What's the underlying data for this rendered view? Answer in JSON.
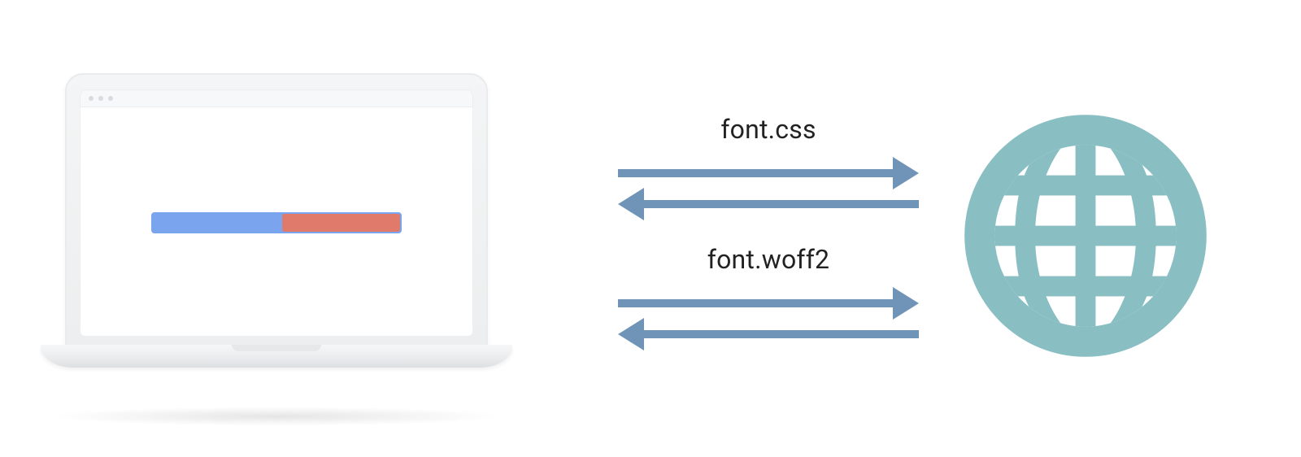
{
  "labels": {
    "request_css": "font.css",
    "request_woff2": "font.woff2"
  },
  "icons": {
    "laptop": "laptop-icon",
    "globe": "globe-icon",
    "arrow_right": "arrow-right-icon",
    "arrow_left": "arrow-left-icon"
  },
  "progress": {
    "completed_color": "#7ba4ef",
    "remaining_color": "#e07a6a",
    "completed_percent": 53,
    "remaining_percent": 47
  },
  "colors": {
    "arrow": "#7094b8",
    "globe": "#89bec3",
    "laptop_body": "#eceeef",
    "text": "#222222"
  }
}
